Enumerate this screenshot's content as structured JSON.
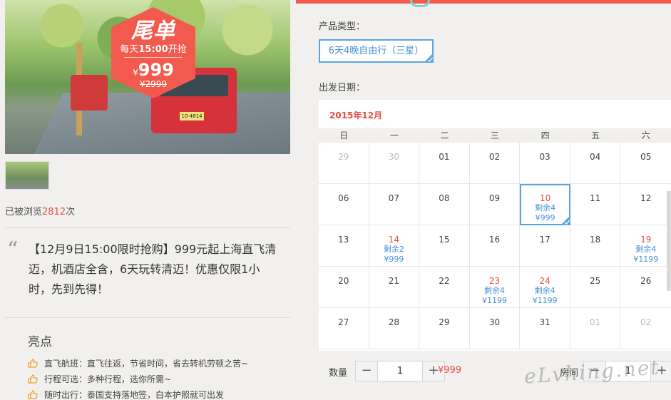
{
  "hero": {
    "badge_title": "尾单",
    "badge_time_prefix": "每天",
    "badge_time": "15:00",
    "badge_time_suffix": "开抢",
    "price_symbol": "¥",
    "price": "999",
    "old_price": "¥2999",
    "plate": "10-4814"
  },
  "views": {
    "prefix": "已被浏览",
    "count": "2812",
    "suffix": "次"
  },
  "promo": {
    "quote_mark": "“",
    "text": "【12月9日15:00限时抢购】999元起上海直飞清迈，机酒店全含，6天玩转清迈！优惠仅限1小时，先到先得！"
  },
  "highlights": {
    "title": "亮点",
    "items": [
      "直飞航班：直飞往返，节省时间，省去转机劳顿之苦~",
      "行程可选：多种行程，选你所需~",
      "随时出行：泰国支持落地签，白本护照就可出发"
    ]
  },
  "product_type": {
    "label": "产品类型：",
    "selected": "6天4晚自由行（三星）"
  },
  "departure": {
    "label": "出发日期："
  },
  "calendar": {
    "month": "2015年12月",
    "weekdays": [
      "日",
      "一",
      "二",
      "三",
      "四",
      "五",
      "六"
    ],
    "rows": [
      [
        {
          "d": "29",
          "t": "other"
        },
        {
          "d": "30",
          "t": "other"
        },
        {
          "d": "01"
        },
        {
          "d": "02"
        },
        {
          "d": "03"
        },
        {
          "d": "04"
        },
        {
          "d": "05"
        }
      ],
      [
        {
          "d": "06"
        },
        {
          "d": "07"
        },
        {
          "d": "08"
        },
        {
          "d": "09"
        },
        {
          "d": "10",
          "t": "red",
          "stock": "剩余4",
          "price": "¥999",
          "selected": true
        },
        {
          "d": "11"
        },
        {
          "d": "12"
        }
      ],
      [
        {
          "d": "13"
        },
        {
          "d": "14",
          "t": "red",
          "stock": "剩余2",
          "price": "¥999"
        },
        {
          "d": "15"
        },
        {
          "d": "16"
        },
        {
          "d": "17"
        },
        {
          "d": "18"
        },
        {
          "d": "19",
          "t": "red",
          "stock": "剩余4",
          "price": "¥1199"
        }
      ],
      [
        {
          "d": "20"
        },
        {
          "d": "21"
        },
        {
          "d": "22"
        },
        {
          "d": "23",
          "t": "red",
          "stock": "剩余4",
          "price": "¥1199"
        },
        {
          "d": "24",
          "t": "red",
          "stock": "剩余4",
          "price": "¥1199"
        },
        {
          "d": "25"
        },
        {
          "d": "26"
        }
      ],
      [
        {
          "d": "27"
        },
        {
          "d": "28"
        },
        {
          "d": "29"
        },
        {
          "d": "30"
        },
        {
          "d": "31"
        },
        {
          "d": "01",
          "t": "other"
        },
        {
          "d": "02",
          "t": "other"
        }
      ]
    ]
  },
  "quantity": {
    "label": "数量",
    "minus": "−",
    "value": "1",
    "plus": "+",
    "price": "¥999"
  },
  "room": {
    "label": "房间",
    "minus": "−",
    "value": "1",
    "plus": "+"
  },
  "watermark": "eLvhing.net",
  "colors": {
    "accent": "#f25a4d",
    "price_red": "#e44f42",
    "select_blue": "#5aa5e0",
    "link_blue": "#4a90d9"
  }
}
